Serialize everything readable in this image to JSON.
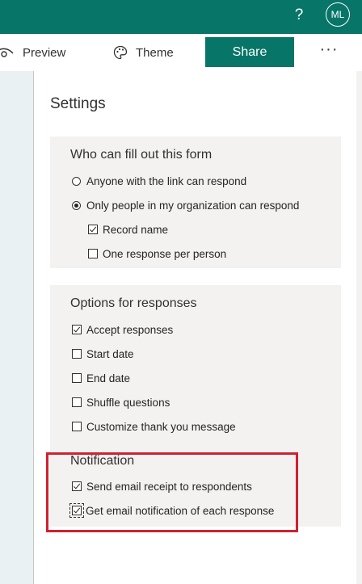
{
  "header": {
    "help_icon": "question-mark-icon",
    "help_label": "?",
    "avatar_initials": "ML",
    "brand_color": "#077568"
  },
  "toolbar": {
    "preview_label": "Preview",
    "preview_icon": "eye-icon",
    "theme_label": "Theme",
    "theme_icon": "palette-icon",
    "share_label": "Share",
    "more_label": "···",
    "more_icon": "more-icon"
  },
  "settings": {
    "title": "Settings",
    "who": {
      "title": "Who can fill out this form",
      "options": [
        {
          "label": "Anyone with the link can respond",
          "selected": false
        },
        {
          "label": "Only people in my organization can respond",
          "selected": true
        }
      ],
      "sub_options": [
        {
          "label": "Record name",
          "checked": true
        },
        {
          "label": "One response per person",
          "checked": false
        }
      ]
    },
    "responses": {
      "title": "Options for responses",
      "items": [
        {
          "label": "Accept responses",
          "checked": true
        },
        {
          "label": "Start date",
          "checked": false
        },
        {
          "label": "End date",
          "checked": false
        },
        {
          "label": "Shuffle questions",
          "checked": false
        },
        {
          "label": "Customize thank you message",
          "checked": false
        }
      ]
    },
    "notification": {
      "title": "Notification",
      "items": [
        {
          "label": "Send email receipt to respondents",
          "checked": true
        },
        {
          "label": "Get email notification of each response",
          "checked": true
        }
      ],
      "highlight_color": "#d1202f"
    }
  }
}
